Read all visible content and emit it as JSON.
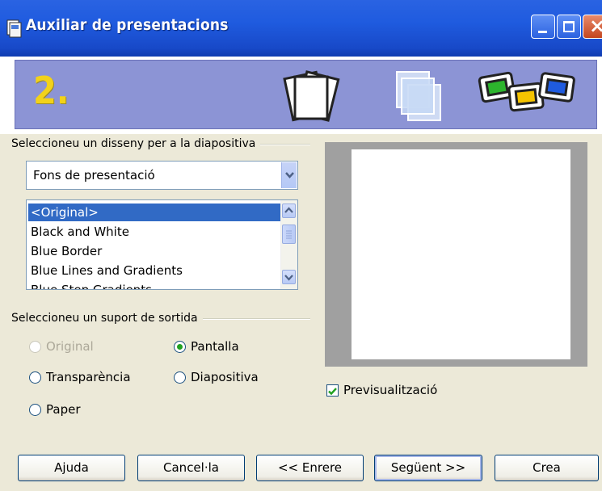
{
  "window": {
    "title": "Auxiliar de presentacions",
    "icon": "presentation-wizard-icon",
    "controls": [
      "minimize-icon",
      "maximize-icon",
      "close-icon"
    ]
  },
  "banner": {
    "step": "2.",
    "icons": [
      "pages-icon",
      "overlapping-slides-icon",
      "colored-slides-icon"
    ]
  },
  "design_group": {
    "label": "Seleccioneu un disseny per a la diapositiva",
    "combo_value": "Fons de presentació",
    "list_items": [
      "<Original>",
      "Black and White",
      "Blue Border",
      "Blue Lines and Gradients",
      "Blue Step Gradients"
    ],
    "selected_index": 0
  },
  "output_group": {
    "label": "Seleccioneu un suport de sortida",
    "options": {
      "original": "Original",
      "pantalla": "Pantalla",
      "transparencia": "Transparència",
      "diapositiva": "Diapositiva",
      "paper": "Paper"
    },
    "selected": "Pantalla"
  },
  "preview": {
    "checkbox_label": "Previsualització",
    "checked": true
  },
  "buttons": {
    "help": "Ajuda",
    "cancel": "Cancel·la",
    "back": "<< Enrere",
    "next": "Següent >>",
    "create": "Crea"
  },
  "colors": {
    "titlebar": "#1F5BDF",
    "banner": "#8C94D5",
    "selection": "#316AC5",
    "dialog_bg": "#ECE9D8"
  }
}
